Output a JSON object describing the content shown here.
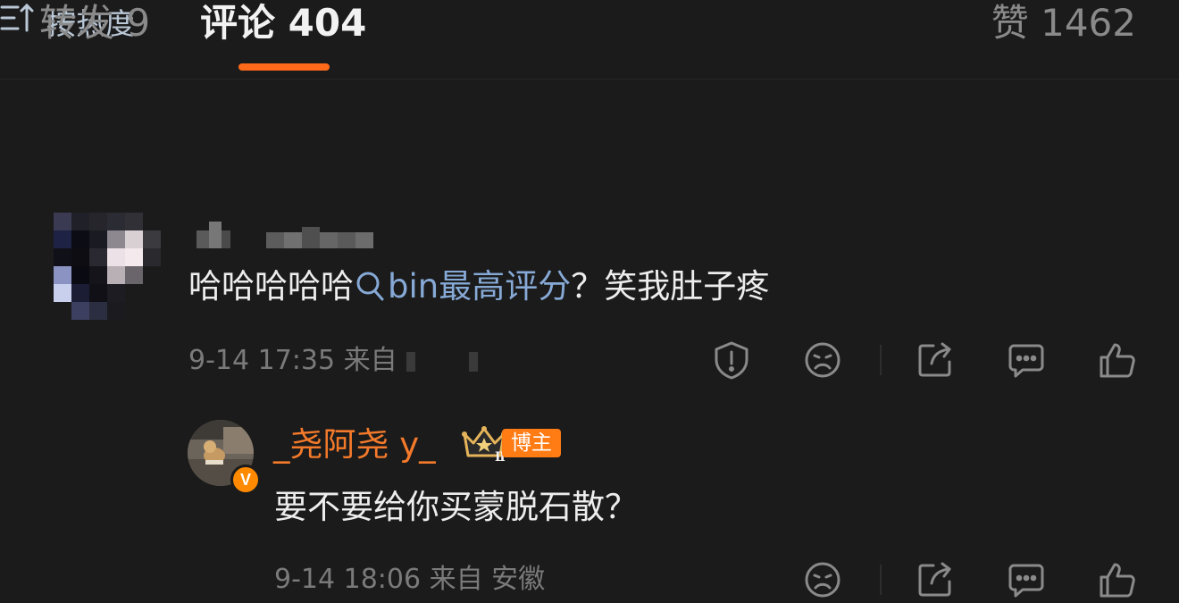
{
  "tabs": {
    "repost": "转发 9",
    "comments": "评论 404",
    "likes": "赞 1462"
  },
  "sort": {
    "label": "按热度"
  },
  "comments": [
    {
      "text_before": "哈哈哈哈哈",
      "topic": "bin最高评分",
      "text_after": "？笑我肚子疼",
      "time": "9-14 17:35",
      "from": "来自"
    }
  ],
  "reply": {
    "username": "_尧阿尧 y_",
    "level_badge": "Ⅱ",
    "role_badge": "博主",
    "verified_badge": "V",
    "text": "要不要给你买蒙脱石散？",
    "time": "9-14 18:06",
    "from": "来自 安徽"
  },
  "colors": {
    "accent": "#ff6a1a",
    "topic": "#86a9d6",
    "username": "#f47a2b",
    "background": "#1b1b1b"
  }
}
